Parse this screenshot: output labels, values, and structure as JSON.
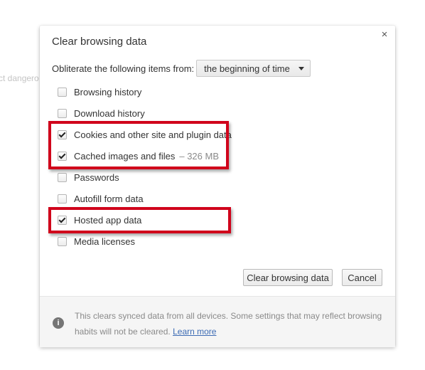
{
  "background": {
    "partial_text": "ct dangero"
  },
  "dialog": {
    "title": "Clear browsing data",
    "close_glyph": "×",
    "obliterate_label": "Obliterate the following items from:",
    "time_range": {
      "selected": "the beginning of time"
    },
    "items": [
      {
        "label": "Browsing history",
        "checked": false
      },
      {
        "label": "Download history",
        "checked": false
      },
      {
        "label": "Cookies and other site and plugin data",
        "checked": true
      },
      {
        "label": "Cached images and files",
        "extra": "–  326 MB",
        "checked": true
      },
      {
        "label": "Passwords",
        "checked": false
      },
      {
        "label": "Autofill form data",
        "checked": false
      },
      {
        "label": "Hosted app data",
        "checked": true
      },
      {
        "label": "Media licenses",
        "checked": false
      }
    ],
    "buttons": {
      "clear": "Clear browsing data",
      "cancel": "Cancel"
    },
    "footer": {
      "text": "This clears synced data from all devices. Some settings that may reflect browsing habits will not be cleared.",
      "link": "Learn more",
      "icon": "info-icon"
    }
  },
  "colors": {
    "highlight": "#d0021b",
    "link": "#3c6bb4"
  }
}
